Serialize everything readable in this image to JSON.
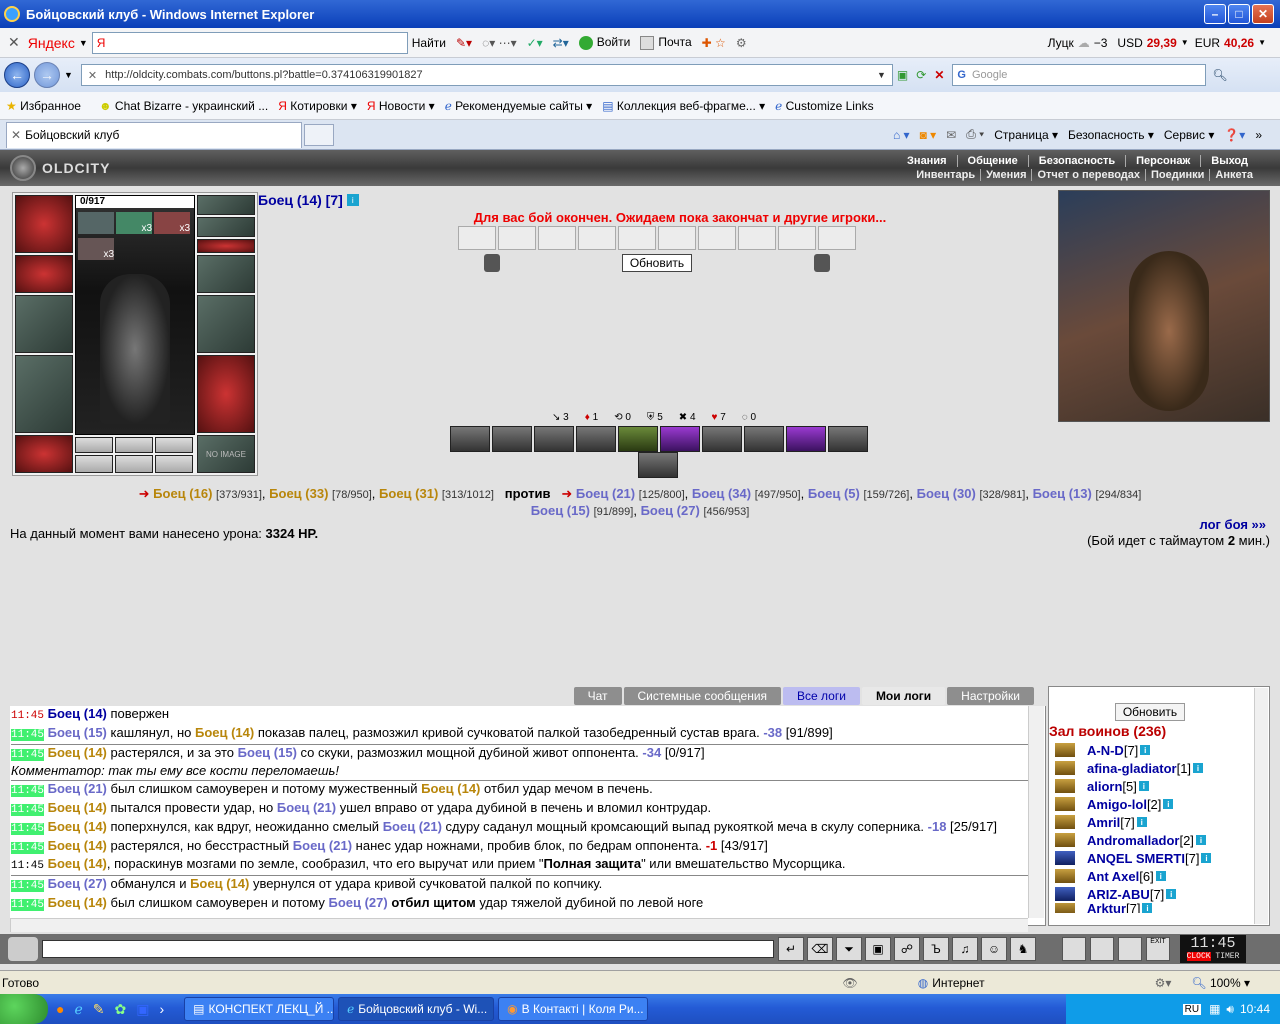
{
  "window": {
    "title": "Бойцовский клуб - Windows Internet Explorer"
  },
  "yandex_bar": {
    "brand": "Яндекс",
    "search_value": "Я",
    "login": "Войти",
    "mail": "Почта",
    "weather_city": "Луцк",
    "weather_temp": "−3",
    "usd_label": "USD",
    "usd_value": "29,39",
    "eur_label": "EUR",
    "eur_value": "40,26"
  },
  "address": {
    "url": "http://oldcity.combats.com/buttons.pl?battle=0.374106319901827",
    "search_placeholder": "Google"
  },
  "favorites": {
    "label": "Избранное",
    "items": [
      "Chat Bizarre - украинский ...",
      "Котировки",
      "Новости",
      "Рекомендуемые сайты",
      "Коллекция веб-фрагме...",
      "Customize Links"
    ]
  },
  "tab": {
    "title": "Бойцовский клуб"
  },
  "commandbar": {
    "page": "Страница",
    "safety": "Безопасность",
    "tools": "Сервис"
  },
  "site": {
    "logo": "OLDCITY",
    "nav_top": [
      "Знания",
      "Общение",
      "Безопасность",
      "Персонаж",
      "Выход"
    ],
    "nav_bottom": [
      "Инвентарь",
      "Умения",
      "Отчет о переводах",
      "Поединки",
      "Анкета"
    ]
  },
  "character": {
    "hp": "0/917",
    "name": "Боец (14) [7]",
    "x3": "x3",
    "no_image": "NO IMAGE"
  },
  "battle": {
    "message": "Для вас бой окончен. Ожидаем пока закончат и другие игроки...",
    "refresh_button": "Обновить",
    "stats": [
      "3",
      "1",
      "0",
      "5",
      "4",
      "7",
      "0"
    ],
    "vs_word": "против",
    "team1": [
      {
        "name": "Боец (16)",
        "hp": "[373/931]"
      },
      {
        "name": "Боец (33)",
        "hp": "[78/950]"
      },
      {
        "name": "Боец (31)",
        "hp": "[313/1012]"
      }
    ],
    "team2": [
      {
        "name": "Боец (21)",
        "hp": "[125/800]"
      },
      {
        "name": "Боец (34)",
        "hp": "[497/950]"
      },
      {
        "name": "Боец (5)",
        "hp": "[159/726]"
      },
      {
        "name": "Боец (30)",
        "hp": "[328/981]"
      },
      {
        "name": "Боец (13)",
        "hp": "[294/834]"
      },
      {
        "name": "Боец (15)",
        "hp": "[91/899]"
      },
      {
        "name": "Боец (27)",
        "hp": "[456/953]"
      }
    ],
    "damage_prefix": "На данный момент вами нанесено урона:",
    "damage_value": "3324 HP.",
    "log_link": "лог боя »»",
    "timeout_prefix": "(Бой идет с таймаутом",
    "timeout_value": "2",
    "timeout_suffix": "мин.)"
  },
  "chat_tabs": [
    "Чат",
    "Системные сообщения",
    "Все логи",
    "Мои логи",
    "Настройки"
  ],
  "log": [
    {
      "time": "11:45",
      "f1": "Боец (14)",
      "text": " повержен"
    },
    {
      "time": "11:45",
      "f1": "Боец (15)",
      "text": " кашлянул, но ",
      "f2": "Боец (14)",
      "text2": " показав палец, размозжил кривой сучковатой палкой тазобедренный сустав врага.",
      "dmg": " -38",
      "hp": " [91/899]"
    },
    {
      "time": "11:45",
      "f1": "Боец (14)",
      "text": " растерялся, и за это ",
      "f2": "Боец (15)",
      "text2": " со скуки, размозжил мощной дубиной живот оппонента.",
      "dmg": " -34",
      "hp": " [0/917]"
    },
    {
      "comment": "Комментатор: так ты ему все кости переломаешь!"
    },
    {
      "time": "11:45",
      "f1": "Боец (21)",
      "text": " был слишком самоуверен и потому мужественный ",
      "f2": "Боец (14)",
      "text2": " отбил удар мечом в печень."
    },
    {
      "time": "11:45",
      "f1": "Боец (14)",
      "text": " пытался провести удар, но ",
      "f2": "Боец (21)",
      "text2": " ушел вправо от удара дубиной в печень и вломил контрудар."
    },
    {
      "time": "11:45",
      "f1": "Боец (14)",
      "text": " поперхнулся, как вдруг, неожиданно смелый ",
      "f2": "Боец (21)",
      "text2": " сдуру саданул мощный кромсающий выпад рукояткой меча в скулу соперника.",
      "dmg": " -18",
      "hp": " [25/917]"
    },
    {
      "time": "11:45",
      "f1": "Боец (14)",
      "text": " растерялся, но бесстрастный ",
      "f2": "Боец (21)",
      "text2": " нанес удар ножнами, пробив блок, по бедрам оппонента.",
      "dmg": " -1",
      "hp": " [43/917]"
    },
    {
      "time": "11:45",
      "f1": "Боец (14)",
      "text": ", пораскинув мозгами по земле, сообразил, что его выручат или прием \"",
      "bold": "Полная защита",
      "text2": "\" или вмешательство Мусорщика."
    },
    {
      "time": "11:45",
      "f1": "Боец (27)",
      "text": " обманулся и ",
      "f2": "Боец (14)",
      "text2": " увернулся от удара кривой сучковатой палкой по копчику."
    },
    {
      "time": "11:45",
      "f1": "Боец (14)",
      "text": " был слишком самоуверен и потому ",
      "f2": "Боец (27)",
      "bold": " отбил щитом",
      "text2": " удар тяжелой дубиной по левой ноге"
    }
  ],
  "roster": {
    "refresh": "Обновить",
    "title": "Зал воинов (236)",
    "players": [
      {
        "name": "A-N-D",
        "lvl": "[7]"
      },
      {
        "name": "afina-gladiator",
        "lvl": "[1]"
      },
      {
        "name": "aliorn",
        "lvl": "[5]"
      },
      {
        "name": "Amigo-lol",
        "lvl": "[2]"
      },
      {
        "name": "Amril",
        "lvl": "[7]"
      },
      {
        "name": "Andromallador",
        "lvl": "[2]"
      },
      {
        "name": "ANQEL SMERTI",
        "lvl": "[7]"
      },
      {
        "name": "Ant Axel",
        "lvl": "[6]"
      },
      {
        "name": "ARIZ-ABU",
        "lvl": "[7]"
      },
      {
        "name": "Arktur",
        "lvl": "[7]"
      }
    ]
  },
  "clock": {
    "time": "11:45",
    "clock": "CLOCK",
    "timer": "TIMER",
    "exit": "EXIT"
  },
  "status": {
    "left": "Готово",
    "zone": "Интернет",
    "zoom": "100%"
  },
  "taskbar": {
    "items": [
      "КОНСПЕКТ ЛЕКЦ_Й ...",
      "Бойцовский клуб - Wi...",
      "В Контакті | Коля Ри..."
    ],
    "lang": "RU",
    "time": "10:44"
  }
}
